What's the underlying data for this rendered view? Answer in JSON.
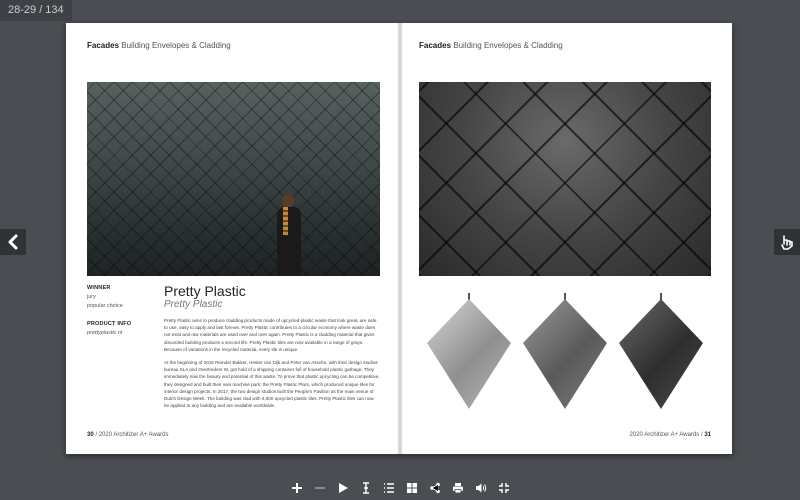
{
  "viewer": {
    "page_counter": "28-29 / 134",
    "toolbar": [
      {
        "name": "zoom-in",
        "icon": "plus-icon"
      },
      {
        "name": "zoom-out",
        "icon": "minus-icon"
      },
      {
        "name": "play",
        "icon": "play-icon"
      },
      {
        "name": "text-select",
        "icon": "text-cursor-icon"
      },
      {
        "name": "table-of-contents",
        "icon": "list-icon"
      },
      {
        "name": "thumbnails",
        "icon": "grid-icon"
      },
      {
        "name": "share",
        "icon": "share-icon"
      },
      {
        "name": "print",
        "icon": "printer-icon"
      },
      {
        "name": "sound",
        "icon": "speaker-icon"
      },
      {
        "name": "fullscreen",
        "icon": "fullscreen-icon"
      }
    ]
  },
  "left_page": {
    "running_head_bold": "Facades",
    "running_head_rest": " Building Envelopes & Cladding",
    "winner_label": "WINNER",
    "winner_values": [
      "jury",
      "popular choice"
    ],
    "product_info_label": "PRODUCT INFO",
    "product_link": "prettyplastic.nl",
    "title": "Pretty Plastic",
    "subtitle": "Pretty Plastic",
    "paragraphs": [
      "Pretty Plastic aims to produce cladding products made of upcycled plastic waste that look great, are safe to use, easy to apply and last forever. Pretty Plastic contributes to a circular economy where waste does not exist and raw materials are used over and over again. Pretty Plastic is a cladding material that gives discarded building products a second life. Pretty Plastic tiles are now available in a range of grays. Because of variations in the recycled material, every tile is unique.",
      "At the beginning of 2016 Reinder Bakker, Hester van Dijk and Peter van Assche, with their design studios bureau SLA and Overtreders W, got hold of a shipping container full of household plastic garbage. They immediately saw the beauty and potential of this waste. To prove that plastic upcycling can be competitive, they designed and built their own machine park: the Pretty Plastic Plant, which produced unique tiles for interior design projects. In 2017, the two design studios built the People's Pavilion as the main venue of Dutch Design Week. The building was clad with 9,000 upcycled plastic tiles. Pretty Plastic tiles can now be applied to any building and are available worldwide."
    ],
    "folio_number": "30",
    "folio_text": " / 2020 Architizer A+ Awards"
  },
  "right_page": {
    "running_head_bold": "Facades",
    "running_head_rest": " Building Envelopes & Cladding",
    "folio_text": "2020 Architizer A+ Awards / ",
    "folio_number": "31"
  },
  "colors": {
    "background": "#4a4d51",
    "page": "#ffffff",
    "toolbar_icon": "#ffffff"
  }
}
